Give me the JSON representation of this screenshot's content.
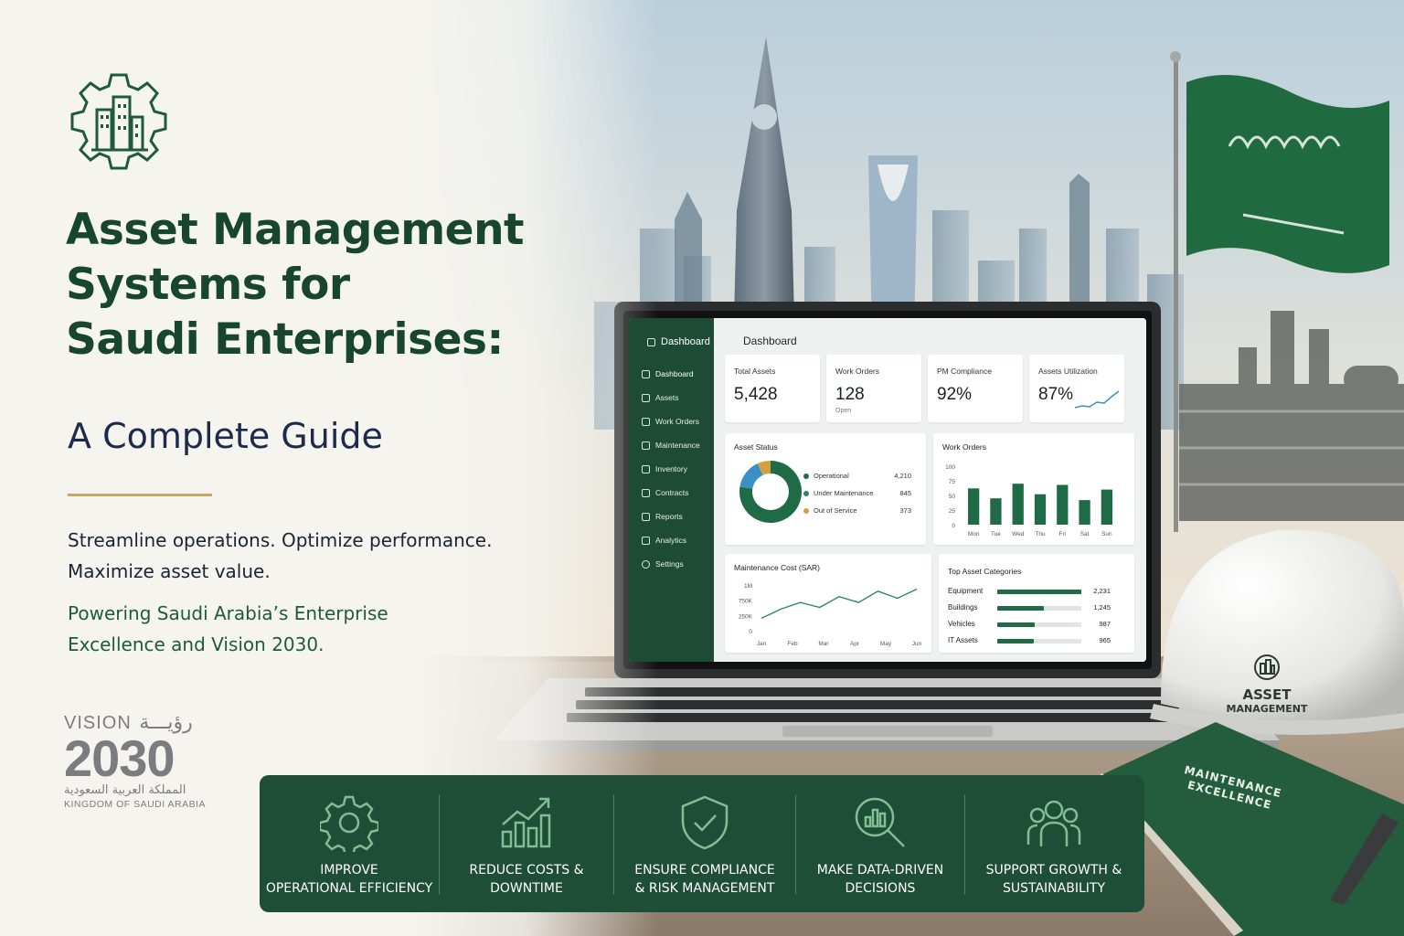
{
  "hero": {
    "title_lines": [
      "Asset Management",
      "Systems for",
      "Saudi Enterprises:"
    ],
    "subtitle": "A Complete Guide",
    "tagline_lines": [
      "Streamline operations. Optimize performance.",
      "Maximize asset value."
    ],
    "vision_lines": [
      "Powering Saudi Arabia’s Enterprise",
      "Excellence and Vision 2030."
    ],
    "logo_icon": "gear-buildings-icon"
  },
  "vision2030": {
    "word": "VISION",
    "arabic_word": "رؤيـــة",
    "year": "2030",
    "arabic_kingdom": "المملكة العربية السعودية",
    "english_kingdom": "KINGDOM OF SAUDI ARABIA"
  },
  "dashboard": {
    "brand": "Dashboard",
    "page_title": "Dashboard",
    "sidebar": [
      {
        "label": "Dashboard",
        "icon": "home-icon"
      },
      {
        "label": "Assets",
        "icon": "box-icon"
      },
      {
        "label": "Work Orders",
        "icon": "clipboard-icon"
      },
      {
        "label": "Maintenance",
        "icon": "wrench-icon"
      },
      {
        "label": "Inventory",
        "icon": "archive-icon"
      },
      {
        "label": "Contracts",
        "icon": "document-icon"
      },
      {
        "label": "Reports",
        "icon": "report-icon"
      },
      {
        "label": "Analytics",
        "icon": "chart-icon"
      },
      {
        "label": "Settings",
        "icon": "gear-icon"
      }
    ],
    "kpis": [
      {
        "label": "Total Assets",
        "value": "5,428",
        "sub": ""
      },
      {
        "label": "Work Orders",
        "value": "128",
        "sub": "Open"
      },
      {
        "label": "PM Compliance",
        "value": "92%",
        "sub": ""
      },
      {
        "label": "Assets Utilization",
        "value": "87%",
        "sub": ""
      }
    ],
    "asset_status": {
      "title": "Asset Status",
      "items": [
        {
          "label": "Operational",
          "value": 4210,
          "display": "4,210",
          "color": "#1f6b45"
        },
        {
          "label": "Under Maintenance",
          "value": 845,
          "display": "845",
          "color": "#3a8fc7"
        },
        {
          "label": "Out of Service",
          "value": 373,
          "display": "373",
          "color": "#d4a03c"
        }
      ]
    },
    "work_orders_chart": {
      "title": "Work Orders",
      "type": "bar",
      "categories": [
        "Mon",
        "Tue",
        "Wed",
        "Thu",
        "Fri",
        "Sat",
        "Sun"
      ],
      "values": [
        62,
        45,
        70,
        52,
        68,
        42,
        60
      ],
      "yticks": [
        "100",
        "75",
        "50",
        "25",
        "0"
      ],
      "ylim": [
        0,
        100
      ]
    },
    "maintenance_cost_chart": {
      "title": "Maintenance Cost (SAR)",
      "type": "line",
      "categories": [
        "Jan",
        "Feb",
        "Mar",
        "Apr",
        "May",
        "Jun"
      ],
      "values": [
        300000,
        520000,
        680000,
        560000,
        820000,
        680000,
        950000,
        780000,
        1000000
      ],
      "yticks": [
        "1M",
        "750K",
        "250K",
        "0"
      ],
      "ylim": [
        0,
        1100000
      ]
    },
    "top_categories": {
      "title": "Top Asset Categories",
      "items": [
        {
          "label": "Equipment",
          "value": 2231,
          "display": "2,231"
        },
        {
          "label": "Buildings",
          "value": 1245,
          "display": "1,245"
        },
        {
          "label": "Vehicles",
          "value": 987,
          "display": "987"
        },
        {
          "label": "IT Assets",
          "value": 965,
          "display": "965"
        }
      ]
    }
  },
  "helmet": {
    "line1": "ASSET",
    "line2": "MANAGEMENT"
  },
  "book": {
    "line1": "MAINTENANCE",
    "line2": "EXCELLENCE"
  },
  "benefits": [
    {
      "icon": "gear-icon",
      "line1": "IMPROVE",
      "line2": "OPERATIONAL EFFICIENCY"
    },
    {
      "icon": "growth-chart-icon",
      "line1": "REDUCE COSTS &",
      "line2": "DOWNTIME"
    },
    {
      "icon": "shield-check-icon",
      "line1": "ENSURE COMPLIANCE",
      "line2": "& RISK MANAGEMENT"
    },
    {
      "icon": "magnifier-chart-icon",
      "line1": "MAKE DATA-DRIVEN",
      "line2": "DECISIONS"
    },
    {
      "icon": "team-icon",
      "line1": "SUPPORT GROWTH &",
      "line2": "SUSTAINABILITY"
    }
  ],
  "colors": {
    "brand_green": "#1e4e37",
    "title_green": "#17452e",
    "gold": "#c4a867",
    "navy": "#1c2b4a"
  }
}
